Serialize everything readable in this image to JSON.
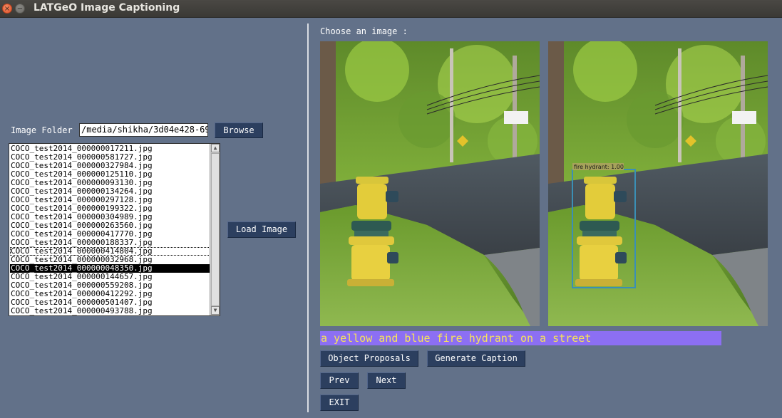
{
  "window": {
    "title": "LATGeO Image Captioning",
    "close_glyph": "×",
    "minimize_glyph": "−"
  },
  "left": {
    "folder_label": "Image Folder",
    "folder_value": "/media/shikha/3d04e428-69",
    "browse_label": "Browse",
    "load_label": "Load Image",
    "files": [
      "COCO_test2014_000000017211.jpg",
      "COCO_test2014_000000581727.jpg",
      "COCO_test2014_000000327984.jpg",
      "COCO_test2014_000000125110.jpg",
      "COCO_test2014_000000093130.jpg",
      "COCO_test2014_000000134264.jpg",
      "COCO_test2014_000000297128.jpg",
      "COCO_test2014_000000199322.jpg",
      "COCO_test2014_000000304989.jpg",
      "COCO_test2014_000000263560.jpg",
      "COCO_test2014_000000417770.jpg",
      "COCO_test2014_000000188337.jpg",
      "COCO_test2014_000000414804.jpg",
      "COCO_test2014_000000032968.jpg",
      "COCO_test2014_000000048350.jpg",
      "COCO_test2014_000000144657.jpg",
      "COCO_test2014_000000559208.jpg",
      "COCO_test2014_000000412292.jpg",
      "COCO_test2014_000000501407.jpg",
      "COCO_test2014_000000493788.jpg"
    ],
    "focused_index": 12,
    "selected_index": 14
  },
  "right": {
    "choose_label": "Choose an image :",
    "detection_label": "fire hydrant: 1.00",
    "caption": "a yellow and blue fire hydrant on a street",
    "object_proposals_label": "Object Proposals",
    "generate_caption_label": "Generate Caption",
    "prev_label": "Prev",
    "next_label": "Next",
    "exit_label": "EXIT"
  },
  "colors": {
    "background": "#627189",
    "button": "#2c3f5f",
    "caption_bg": "#8c6ff3",
    "caption_text": "#f6e35a",
    "detection_box": "#3b8fb5"
  }
}
